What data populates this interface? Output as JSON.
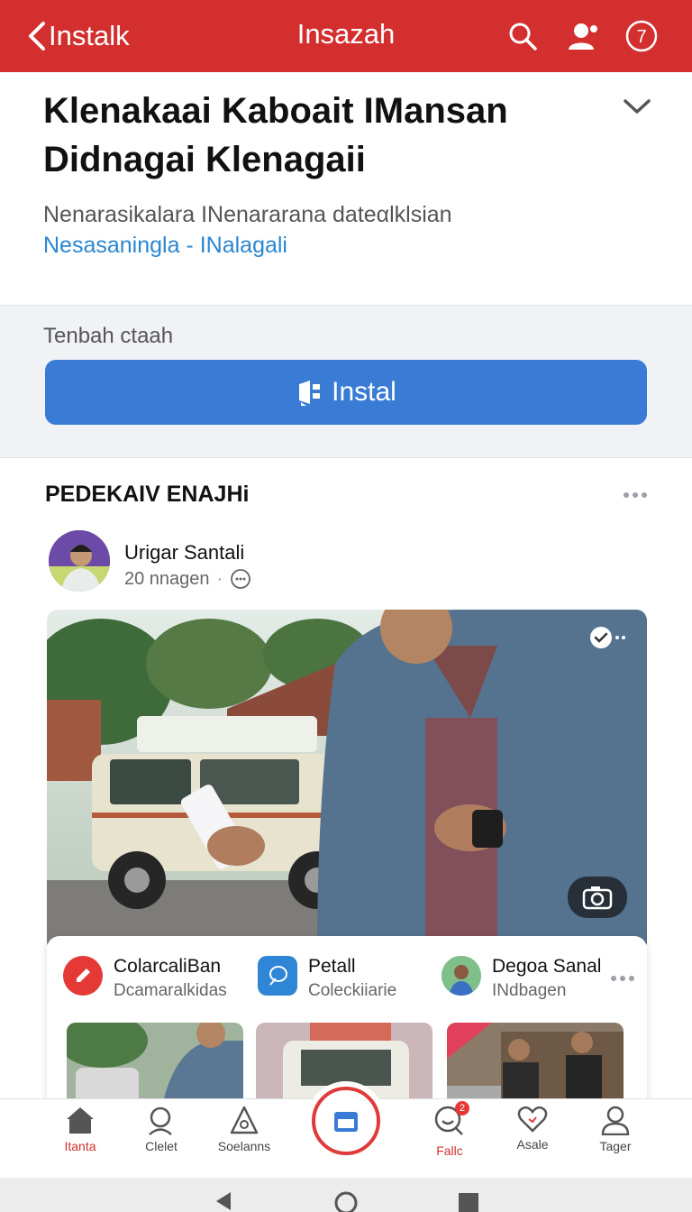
{
  "topbar": {
    "back_label": "Instalk",
    "title": "Insazah",
    "notification_count": "7",
    "color": "#d32f2f"
  },
  "header": {
    "title": "Klenakaai Kaboait IMansan Didnagai Klenagaii",
    "subtitle": "Nenarasikalara INenararana dateαlklsian",
    "link": "Nesasaningla - INalagali"
  },
  "install": {
    "label": "Tenbah ctaah",
    "button_label": "Instal",
    "button_color": "#3a7bd5"
  },
  "feed": {
    "section_title": "PEDEKAIV ENAJHi",
    "author": "Urigar Santali",
    "time": "20 nnagen"
  },
  "suggestions": [
    {
      "name": "ColarcaliBan",
      "sub": "Dcamaralkidas",
      "icon": "edit-icon",
      "color": "#e53935"
    },
    {
      "name": "Petall",
      "sub": "Coleckiiarie",
      "icon": "leaf-icon",
      "color": "#2f86d6"
    },
    {
      "name": "Degoa Sanal",
      "sub": "INdbagen",
      "icon": "avatar",
      "color": "#7fbf8a"
    }
  ],
  "bottom_nav": [
    {
      "label": "Itanta",
      "icon": "home-icon"
    },
    {
      "label": "Clelet",
      "icon": "search-icon"
    },
    {
      "label": "Soelanns",
      "icon": "alert-icon"
    },
    {
      "label": "Fallc",
      "icon": "chat-icon",
      "badge": "2"
    },
    {
      "label": "Asale",
      "icon": "heart-icon"
    },
    {
      "label": "Tager",
      "icon": "profile-icon"
    }
  ]
}
